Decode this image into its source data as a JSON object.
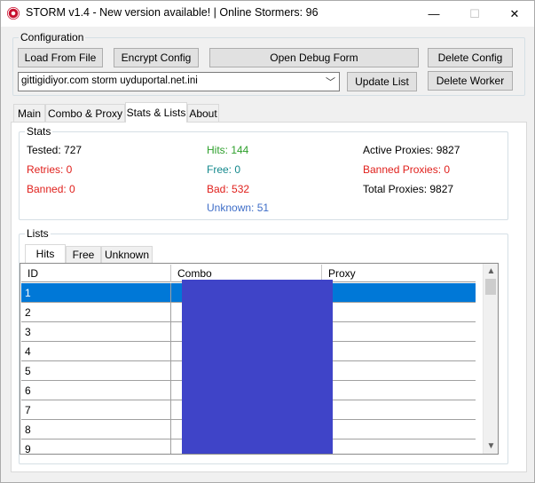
{
  "window": {
    "title": "STORM v1.4 - New version available! | Online Stormers: 96",
    "minimize": "—",
    "maximize": "☐",
    "close": "✕"
  },
  "config": {
    "group_label": "Configuration",
    "load_from_file": "Load From File",
    "encrypt_config": "Encrypt Config",
    "open_debug_form": "Open Debug Form",
    "delete_config": "Delete Config",
    "selected_config": "gittigidiyor.com storm uyduportal.net.ini",
    "update_list": "Update List",
    "delete_worker": "Delete Worker"
  },
  "tabs": [
    {
      "label": "Main"
    },
    {
      "label": "Combo & Proxy"
    },
    {
      "label": "Stats & Lists"
    },
    {
      "label": "About"
    }
  ],
  "stats": {
    "group_label": "Stats",
    "tested": "Tested: 727",
    "retries": "Retries: 0",
    "banned": "Banned: 0",
    "hits": "Hits: 144",
    "free": "Free: 0",
    "bad": "Bad: 532",
    "unknown": "Unknown: 51",
    "active_proxies": "Active Proxies: 9827",
    "banned_proxies": "Banned Proxies: 0",
    "total_proxies": "Total Proxies: 9827",
    "colors": {
      "red": "#e0201c",
      "green": "#2ea02c",
      "teal": "#13888c",
      "blue": "#3f6ec8",
      "selection": "#0078d7"
    }
  },
  "lists": {
    "group_label": "Lists",
    "subtabs": [
      {
        "label": "Hits"
      },
      {
        "label": "Free"
      },
      {
        "label": "Unknown"
      }
    ],
    "columns": {
      "id": "ID",
      "combo": "Combo",
      "proxy": "Proxy"
    },
    "rows": [
      {
        "id": "1"
      },
      {
        "id": "2"
      },
      {
        "id": "3"
      },
      {
        "id": "4"
      },
      {
        "id": "5"
      },
      {
        "id": "6"
      },
      {
        "id": "7"
      },
      {
        "id": "8"
      },
      {
        "id": "9"
      }
    ],
    "scroll_up": "▲",
    "scroll_down": "▼",
    "combo_arrow": "﹀"
  }
}
